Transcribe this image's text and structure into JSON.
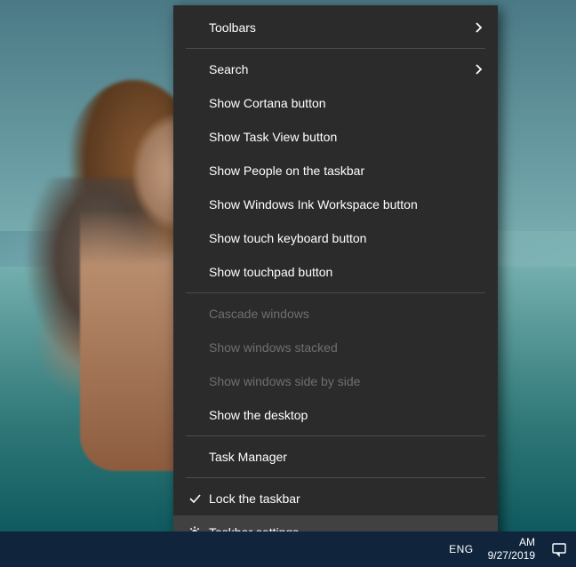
{
  "menu": {
    "group1": [
      {
        "label": "Toolbars",
        "submenu": true
      }
    ],
    "group2": [
      {
        "label": "Search",
        "submenu": true
      },
      {
        "label": "Show Cortana button"
      },
      {
        "label": "Show Task View button"
      },
      {
        "label": "Show People on the taskbar"
      },
      {
        "label": "Show Windows Ink Workspace button"
      },
      {
        "label": "Show touch keyboard button"
      },
      {
        "label": "Show touchpad button"
      }
    ],
    "group3": [
      {
        "label": "Cascade windows",
        "disabled": true
      },
      {
        "label": "Show windows stacked",
        "disabled": true
      },
      {
        "label": "Show windows side by side",
        "disabled": true
      },
      {
        "label": "Show the desktop"
      }
    ],
    "group4": [
      {
        "label": "Task Manager"
      }
    ],
    "group5": [
      {
        "label": "Lock the taskbar",
        "icon": "check"
      },
      {
        "label": "Taskbar settings",
        "icon": "gear",
        "hovered": true
      }
    ]
  },
  "tray": {
    "lang": "ENG",
    "time_suffix": "AM",
    "date": "9/27/2019"
  }
}
